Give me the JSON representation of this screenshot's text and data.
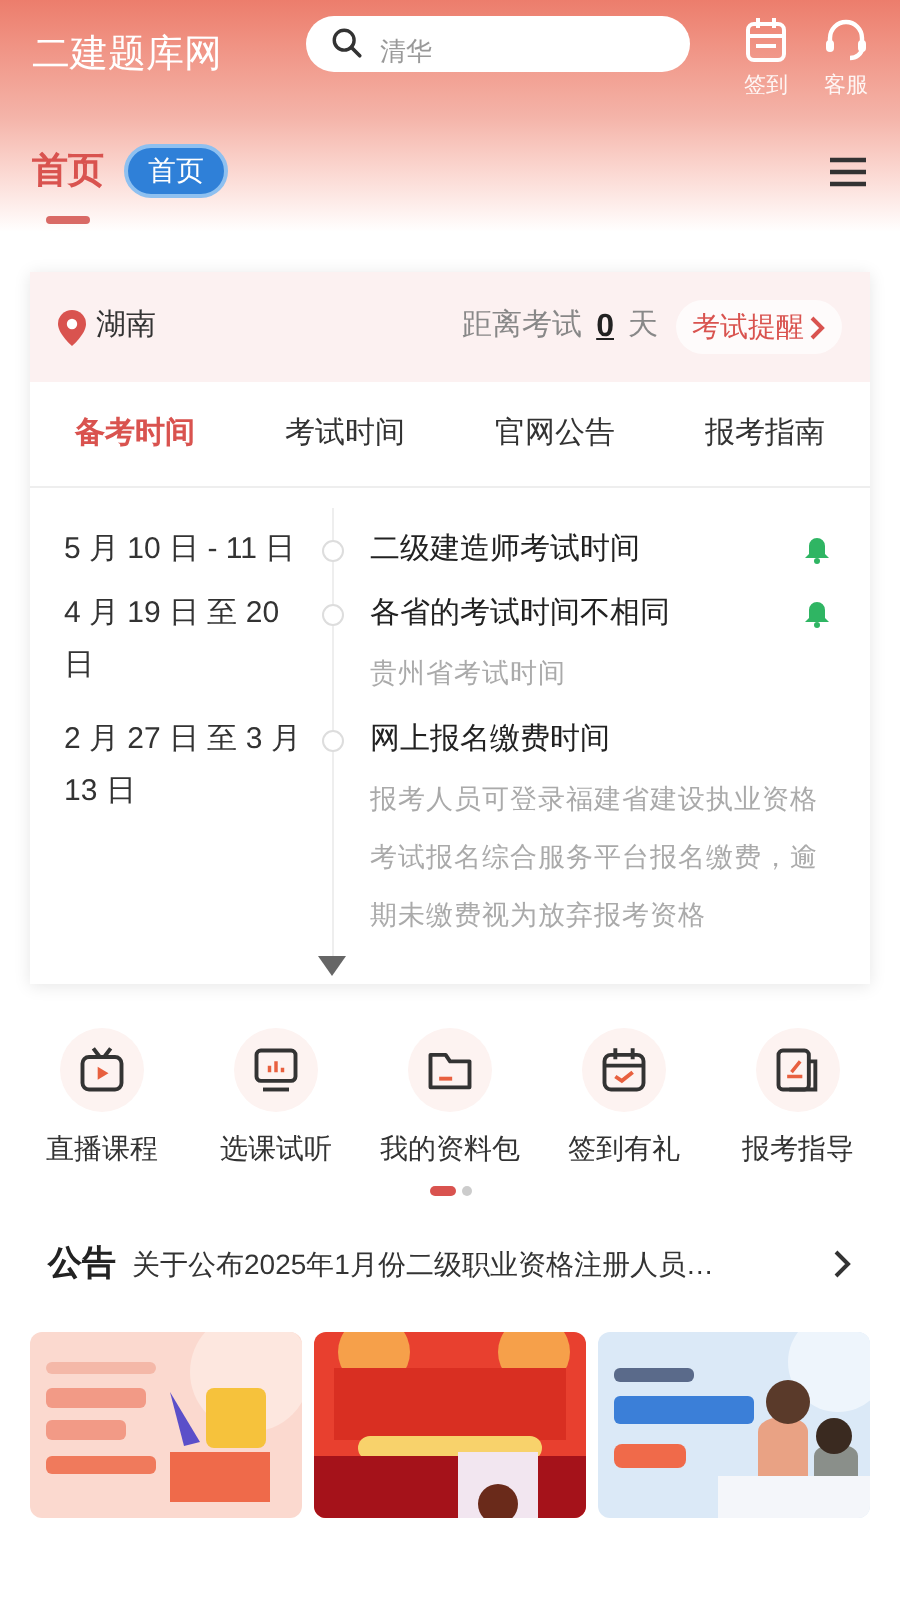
{
  "header": {
    "title": "二建题库网",
    "search": {
      "placeholder": "清华"
    },
    "actions": [
      {
        "kind": "calendar",
        "label": "签到"
      },
      {
        "kind": "headset",
        "label": "客服"
      }
    ]
  },
  "nav": {
    "tab": {
      "label": "首页",
      "selected": true
    },
    "badge": "首页"
  },
  "exam_card": {
    "location": "湖南",
    "countdown": {
      "prefix": "距离考试",
      "days": "0",
      "suffix": "天"
    },
    "reminder_button": "考试提醒",
    "tabs": [
      {
        "label": "备考时间",
        "selected": true
      },
      {
        "label": "考试时间",
        "selected": false
      },
      {
        "label": "官网公告",
        "selected": false
      },
      {
        "label": "报考指南",
        "selected": false
      }
    ],
    "timeline": [
      {
        "date": "5 月 10 日 - 11 日",
        "title": "二级建造师考试时间",
        "reminder": true
      },
      {
        "date": "4 月 19 日 至 20 日",
        "title": "各省的考试时间不相同",
        "note": "贵州省考试时间",
        "reminder": true
      },
      {
        "date": "2 月 27 日 至 3 月 13 日",
        "title": "网上报名缴费时间",
        "note": "报考人员可登录福建省建设执业资格考试报名综合服务平台报名缴费，逾期未缴费视为放弃报考资格",
        "reminder": false
      }
    ]
  },
  "shortcuts": [
    {
      "kind": "tv",
      "label": "直播课程"
    },
    {
      "kind": "monitor",
      "label": "选课试听"
    },
    {
      "kind": "folder",
      "label": "我的资料包"
    },
    {
      "kind": "calendar",
      "label": "签到有礼"
    },
    {
      "kind": "document",
      "label": "报考指导"
    }
  ],
  "pager": [
    {
      "selected": true
    },
    {
      "selected": false
    }
  ],
  "notice": {
    "label": "公告",
    "text": "关于公布2025年1月份二级职业资格注册人员…"
  }
}
